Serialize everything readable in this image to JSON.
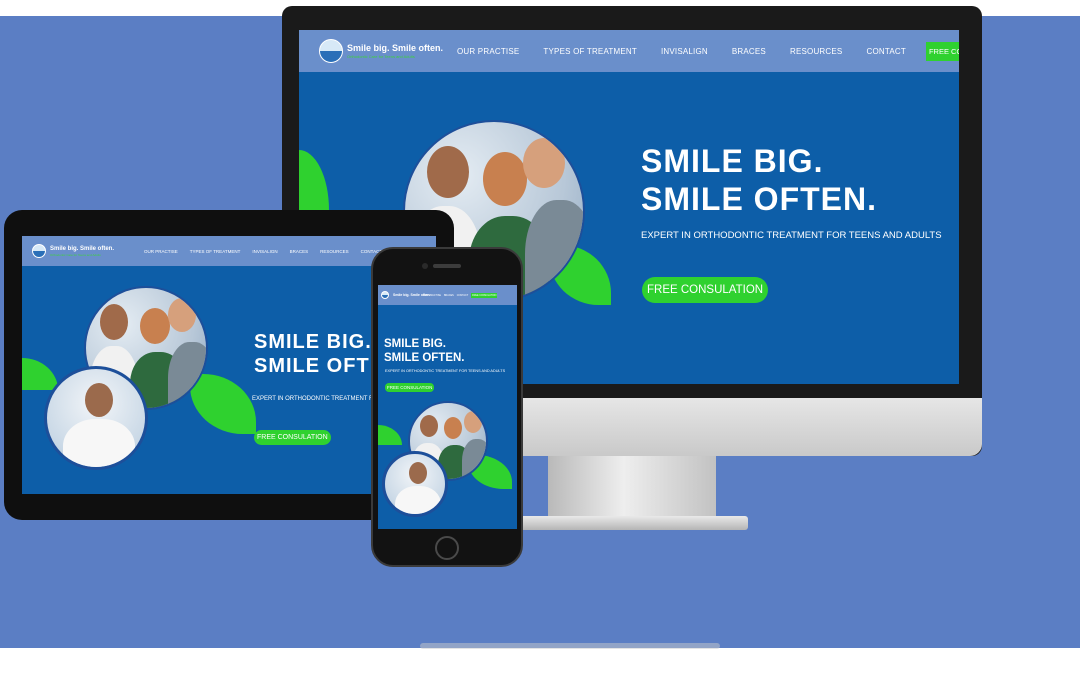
{
  "site": {
    "logo_title": "Smile big. Smile often.",
    "logo_subtitle": "Orthodontic Care for Teens and Adults",
    "nav": {
      "items": [
        "OUR PRACTISE",
        "TYPES OF TREATMENT",
        "INVISALIGN",
        "BRACES",
        "RESOURCES",
        "CONTACT"
      ],
      "cta": "FREE CONSULATION"
    },
    "hero": {
      "title_line1": "SMILE BIG.",
      "title_line2": "SMILE OFTEN.",
      "subtitle": "EXPERT IN ORTHODONTIC TREATMENT FOR TEENS AND ADULTS",
      "cta": "FREE CONSULATION"
    },
    "tablet_hero_title_line2": "SMILE OFT",
    "tablet_hero_subtitle": "EXPERT IN ORTHODONTIC TREATMENT FOR T"
  },
  "colors": {
    "page_background": "#5b7ec4",
    "hero_blue": "#0d5ea8",
    "nav_blue": "#6a8fcb",
    "accent_green": "#2fd12f"
  },
  "icons": {
    "logo": "smile-globe-icon"
  }
}
